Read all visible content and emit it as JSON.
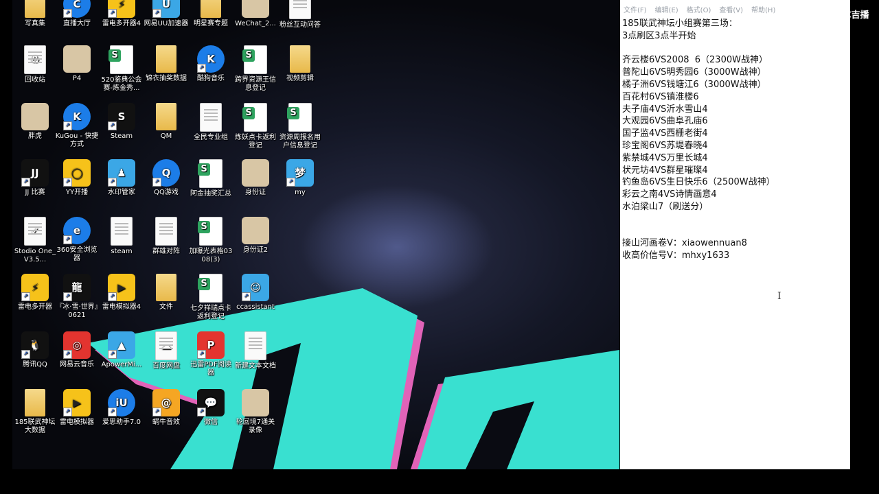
{
  "desktop": {
    "icons": [
      {
        "label": "写真集",
        "kind": "folder",
        "glyph": ""
      },
      {
        "label": "直播大厅",
        "kind": "blue",
        "glyph": "C"
      },
      {
        "label": "雷电多开器4",
        "kind": "yellow",
        "glyph": "⚡"
      },
      {
        "label": "网易UU加速器",
        "kind": "teal",
        "glyph": "U"
      },
      {
        "label": "明星赛专题",
        "kind": "folder",
        "glyph": ""
      },
      {
        "label": "WeChat_2...",
        "kind": "pic",
        "glyph": ""
      },
      {
        "label": "粉丝互动问答",
        "kind": "doc",
        "glyph": ""
      },
      {
        "label": "回收站",
        "kind": "doc",
        "glyph": "♻"
      },
      {
        "label": "P4",
        "kind": "pic",
        "glyph": ""
      },
      {
        "label": "520鉴典公会赛-炼金秀...",
        "kind": "sheet",
        "glyph": "S"
      },
      {
        "label": "锦衣抽奖数据",
        "kind": "folder",
        "glyph": ""
      },
      {
        "label": "酷狗音乐",
        "kind": "blue",
        "glyph": "K"
      },
      {
        "label": "跨界资源王信息登记",
        "kind": "sheet",
        "glyph": "S"
      },
      {
        "label": "视频剪辑",
        "kind": "folder",
        "glyph": ""
      },
      {
        "label": "胖虎",
        "kind": "pic",
        "glyph": ""
      },
      {
        "label": "KuGou - 快捷方式",
        "kind": "blue",
        "glyph": "K"
      },
      {
        "label": "Steam",
        "kind": "black",
        "glyph": "S"
      },
      {
        "label": "QM",
        "kind": "folder",
        "glyph": ""
      },
      {
        "label": "全民专业组",
        "kind": "doc",
        "glyph": ""
      },
      {
        "label": "炼妖点卡返利登记",
        "kind": "sheet",
        "glyph": "S"
      },
      {
        "label": "资源周报名用户信息登记",
        "kind": "sheet",
        "glyph": "S"
      },
      {
        "label": "JJ 比赛",
        "kind": "black",
        "glyph": "JJ"
      },
      {
        "label": "YY开播",
        "kind": "yellow",
        "glyph": "◯"
      },
      {
        "label": "水印管家",
        "kind": "teal",
        "glyph": "♟"
      },
      {
        "label": "QQ游戏",
        "kind": "blue",
        "glyph": "Q"
      },
      {
        "label": "阿金抽奖汇总",
        "kind": "sheet",
        "glyph": "S"
      },
      {
        "label": "身份证",
        "kind": "pic",
        "glyph": ""
      },
      {
        "label": "my",
        "kind": "teal",
        "glyph": "梦"
      },
      {
        "label": "Stodio One_V3.5...",
        "kind": "doc",
        "glyph": "✓"
      },
      {
        "label": "360安全浏览器",
        "kind": "blue",
        "glyph": "e"
      },
      {
        "label": "steam",
        "kind": "doc",
        "glyph": ""
      },
      {
        "label": "群雄对阵",
        "kind": "doc",
        "glyph": ""
      },
      {
        "label": "加曝光表格0308(3)",
        "kind": "sheet",
        "glyph": "S"
      },
      {
        "label": "身份证2",
        "kind": "pic",
        "glyph": ""
      },
      {
        "label": "",
        "kind": "none",
        "glyph": ""
      },
      {
        "label": "雷电多开器",
        "kind": "yellow",
        "glyph": "⚡"
      },
      {
        "label": "『冰·雪·世界』0621",
        "kind": "black",
        "glyph": "龍"
      },
      {
        "label": "雷电模拟器4",
        "kind": "yellow",
        "glyph": "▶"
      },
      {
        "label": "文件",
        "kind": "folder",
        "glyph": ""
      },
      {
        "label": "七夕祥瑞点卡返利登记",
        "kind": "sheet",
        "glyph": "S"
      },
      {
        "label": "ccassistant",
        "kind": "teal",
        "glyph": "☺"
      },
      {
        "label": "",
        "kind": "none",
        "glyph": ""
      },
      {
        "label": "腾讯QQ",
        "kind": "black",
        "glyph": "🐧"
      },
      {
        "label": "网易云音乐",
        "kind": "red",
        "glyph": "◎"
      },
      {
        "label": "ApowerMi...",
        "kind": "teal",
        "glyph": "▲"
      },
      {
        "label": "百度网盘",
        "kind": "doc",
        "glyph": "☁"
      },
      {
        "label": "迅雷PDF阅读器",
        "kind": "red",
        "glyph": "P"
      },
      {
        "label": "新建文本文档",
        "kind": "doc",
        "glyph": ""
      },
      {
        "label": "",
        "kind": "none",
        "glyph": ""
      },
      {
        "label": "185联武神坛大数据",
        "kind": "folder",
        "glyph": ""
      },
      {
        "label": "雷电模拟器",
        "kind": "yellow",
        "glyph": "▶"
      },
      {
        "label": "爱思助手7.0",
        "kind": "blue",
        "glyph": "iU"
      },
      {
        "label": "蜗牛音效",
        "kind": "orange",
        "glyph": "@"
      },
      {
        "label": "微信",
        "kind": "black",
        "glyph": "💬"
      },
      {
        "label": "轮回境7通关录像",
        "kind": "pic",
        "glyph": ""
      },
      {
        "label": "",
        "kind": "none",
        "glyph": ""
      }
    ]
  },
  "notepad": {
    "menu": [
      "文件(F)",
      "编辑(E)",
      "格式(O)",
      "查看(V)",
      "帮助(H)"
    ],
    "lines": [
      "185联武神坛小组赛第三场：",
      "3点刷区3点半开始",
      "",
      "齐云楼6VS2008  6（2300W战神）",
      "普陀山6VS明秀园6（3000W战神）",
      "橘子洲6VS钱塘江6（3000W战神）",
      "百花村6VS镇淮楼6",
      "夫子庙4VS沂水雪山4",
      "大观园6VS曲阜孔庙6",
      "国子监4VS西栅老街4",
      "珍宝阁6VS苏堤春晓4",
      "紫禁城4VS万里长城4",
      "状元坊4VS群星璀璨4",
      "钓鱼岛6VS生日快乐6（2500W战神）",
      "彩云之南4VS诗情画意4",
      "水泊梁山7（刷送分）",
      "",
      "",
      "接山河画卷V：xiaowennuan8",
      "收高价信号V：mhxy1633"
    ]
  },
  "watermark": "C吉播",
  "cursor_glyph": "I"
}
